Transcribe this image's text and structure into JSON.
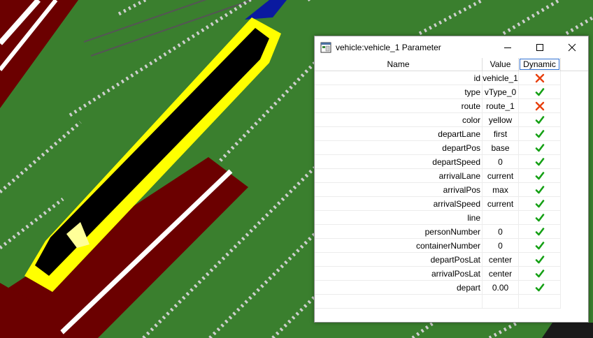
{
  "window": {
    "title": "vehicle:vehicle_1 Parameter",
    "controls": {
      "minimize": "minimize",
      "maximize": "maximize",
      "close": "close"
    }
  },
  "table": {
    "columns": [
      "Name",
      "Value",
      "Dynamic"
    ],
    "rows": [
      {
        "name": "id",
        "value": "vehicle_1",
        "dynamic": false
      },
      {
        "name": "type",
        "value": "vType_0",
        "dynamic": true
      },
      {
        "name": "route",
        "value": "route_1",
        "dynamic": false
      },
      {
        "name": "color",
        "value": "yellow",
        "dynamic": true
      },
      {
        "name": "departLane",
        "value": "first",
        "dynamic": true
      },
      {
        "name": "departPos",
        "value": "base",
        "dynamic": true
      },
      {
        "name": "departSpeed",
        "value": "0",
        "dynamic": true
      },
      {
        "name": "arrivalLane",
        "value": "current",
        "dynamic": true
      },
      {
        "name": "arrivalPos",
        "value": "max",
        "dynamic": true
      },
      {
        "name": "arrivalSpeed",
        "value": "current",
        "dynamic": true
      },
      {
        "name": "line",
        "value": "",
        "dynamic": true
      },
      {
        "name": "personNumber",
        "value": "0",
        "dynamic": true
      },
      {
        "name": "containerNumber",
        "value": "0",
        "dynamic": true
      },
      {
        "name": "departPosLat",
        "value": "center",
        "dynamic": true
      },
      {
        "name": "arrivalPosLat",
        "value": "center",
        "dynamic": true
      },
      {
        "name": "depart",
        "value": "0.00",
        "dynamic": true
      }
    ]
  },
  "icons": {
    "dynamic_true": "green-checkmark-icon",
    "dynamic_false": "red-x-icon"
  },
  "colors": {
    "grass": "#3a7f2e",
    "road": "#6b0000",
    "selection": "#ffff00",
    "vehicle": "#000000",
    "check": "#15a015",
    "cross": "#e8400e"
  }
}
